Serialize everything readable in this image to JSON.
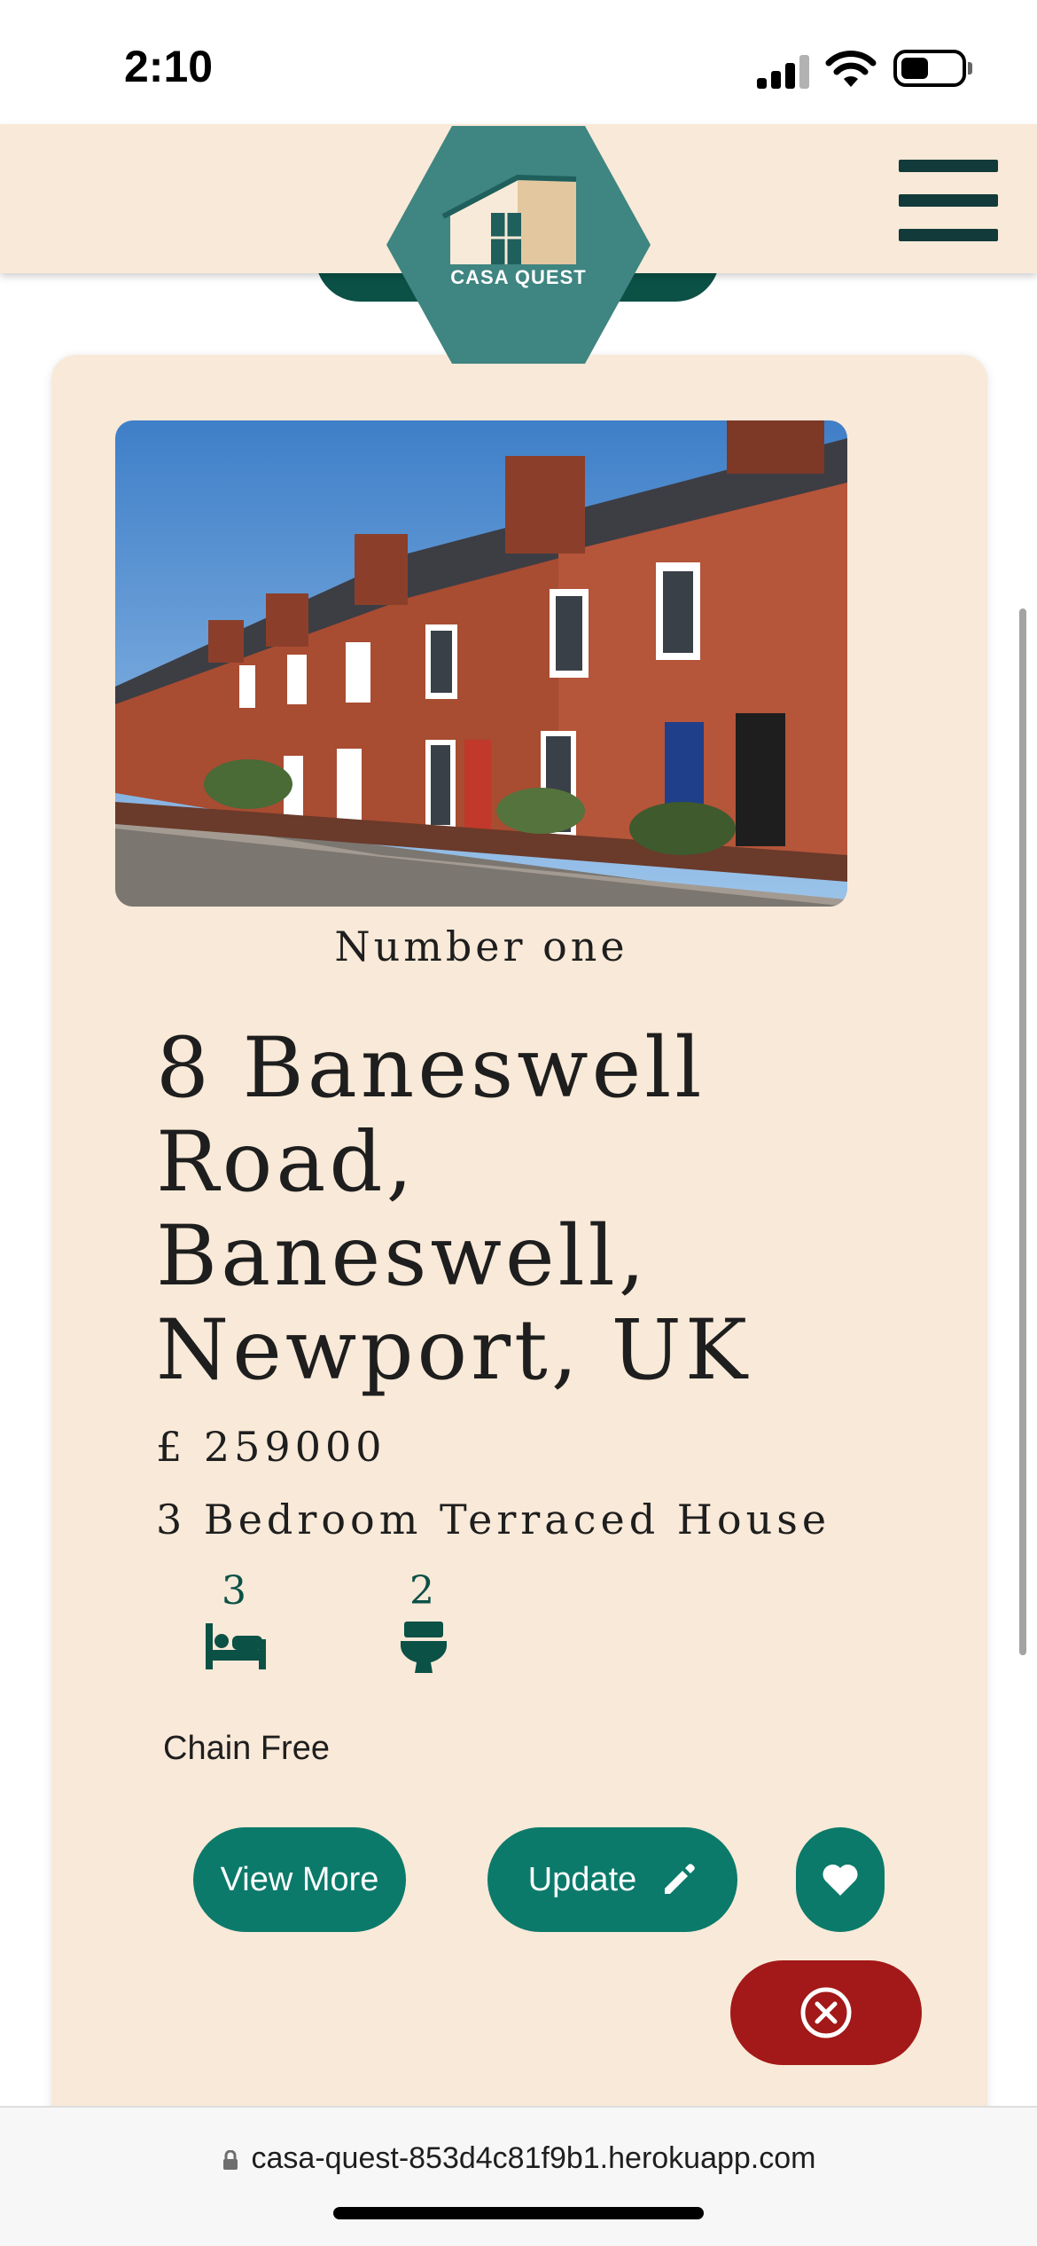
{
  "status_bar": {
    "time": "2:10",
    "icons": [
      "cellular-signal-icon",
      "wifi-icon",
      "battery-icon"
    ]
  },
  "header": {
    "logo_text": "CASA QUEST",
    "menu_icon": "hamburger-menu-icon",
    "colors": {
      "background": "#f9e9d8",
      "logo_teal": "#3f8581",
      "dark_teal": "#0b5146"
    }
  },
  "listing": {
    "photo_alt": "Row of red brick terraced houses",
    "photo_caption": "Number one",
    "address": "8 Baneswell Road, Baneswell, Newport, UK",
    "price": "£ 259000",
    "house_type": "3 Bedroom Terraced House",
    "bedrooms": "3",
    "bathrooms": "2",
    "chain_status": "Chain Free"
  },
  "actions": {
    "view_more_label": "View More",
    "update_label": "Update",
    "favourite_icon": "heart-icon",
    "delete_icon": "close-circle-icon",
    "colors": {
      "primary": "#0b7a6a",
      "danger": "#a31818"
    }
  },
  "browser": {
    "url": "casa-quest-853d4c81f9b1.herokuapp.com"
  }
}
